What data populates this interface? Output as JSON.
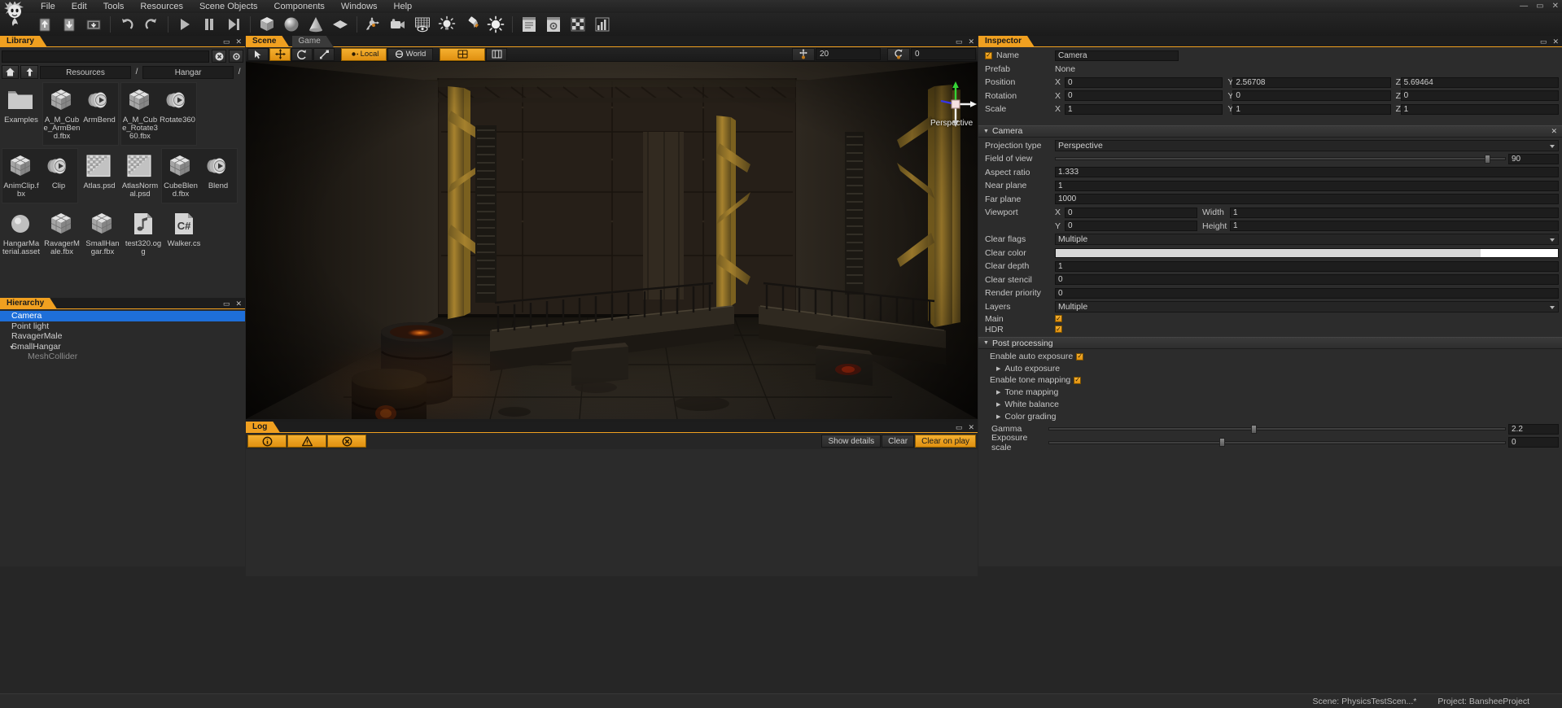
{
  "menu": {
    "items": [
      "File",
      "Edit",
      "Tools",
      "Resources",
      "Scene Objects",
      "Components",
      "Windows",
      "Help"
    ],
    "window_controls": [
      "—",
      "▭",
      "✕"
    ]
  },
  "toolbar": {
    "buttons": [
      {
        "name": "save-scene-icon",
        "title": "Save scene"
      },
      {
        "name": "load-scene-icon",
        "title": "Load scene"
      },
      {
        "name": "import-resource-icon",
        "title": "Import resource"
      },
      {
        "name": "undo-icon",
        "title": "Undo"
      },
      {
        "name": "redo-icon",
        "title": "Redo"
      },
      {
        "name": "play-icon",
        "title": "Play"
      },
      {
        "name": "pause-icon",
        "title": "Pause"
      },
      {
        "name": "step-icon",
        "title": "Step"
      },
      {
        "name": "add-cube-icon",
        "title": "Add cube"
      },
      {
        "name": "add-sphere-icon",
        "title": "Add sphere"
      },
      {
        "name": "add-cone-icon",
        "title": "Add cone"
      },
      {
        "name": "add-quad-icon",
        "title": "Add quad"
      },
      {
        "name": "add-empty-object-icon",
        "title": "Add empty scene object"
      },
      {
        "name": "add-camera-icon",
        "title": "Add camera"
      },
      {
        "name": "add-renderable-icon",
        "title": "Add renderable"
      },
      {
        "name": "add-point-light-icon",
        "title": "Add point light"
      },
      {
        "name": "add-spot-light-icon",
        "title": "Add spot light"
      },
      {
        "name": "add-directional-light-icon",
        "title": "Add directional light"
      },
      {
        "name": "project-settings-icon",
        "title": "Project settings"
      },
      {
        "name": "editor-settings-icon",
        "title": "Editor settings"
      },
      {
        "name": "build-icon",
        "title": "Build"
      },
      {
        "name": "profiler-icon",
        "title": "Profiler"
      }
    ]
  },
  "library": {
    "tab": "Library",
    "controls": [
      "▭",
      "✕"
    ],
    "search_value": "",
    "search_placeholder": "",
    "clear_search_icon": "clear-search-icon",
    "options_icon": "options-gear-icon",
    "home_icon": "home-icon",
    "up_icon": "up-arrow-icon",
    "breadcrumb": [
      "Resources",
      "/",
      "Hangar",
      "/"
    ],
    "groups": [
      {
        "standalone": true,
        "entries": [
          {
            "label": "Examples",
            "icon": "folder-icon"
          }
        ]
      },
      {
        "standalone": false,
        "entries": [
          {
            "label": "A_M_Cube_ArmBend.fbx",
            "icon": "mesh-icon"
          },
          {
            "label": "ArmBend",
            "icon": "animation-icon"
          }
        ]
      },
      {
        "standalone": false,
        "entries": [
          {
            "label": "A_M_Cube_Rotate360.fbx",
            "icon": "mesh-icon"
          },
          {
            "label": "Rotate360",
            "icon": "animation-icon"
          }
        ]
      },
      {
        "standalone": false,
        "entries": [
          {
            "label": "AnimClip.fbx",
            "icon": "mesh-icon"
          },
          {
            "label": "Clip",
            "icon": "animation-icon"
          }
        ]
      },
      {
        "standalone": true,
        "entries": [
          {
            "label": "Atlas.psd",
            "icon": "texture-icon"
          }
        ]
      },
      {
        "standalone": true,
        "entries": [
          {
            "label": "AtlasNormal.psd",
            "icon": "texture-icon"
          }
        ]
      },
      {
        "standalone": false,
        "entries": [
          {
            "label": "CubeBlend.fbx",
            "icon": "mesh-icon"
          },
          {
            "label": "Blend",
            "icon": "animation-icon"
          }
        ]
      },
      {
        "standalone": true,
        "entries": [
          {
            "label": "HangarMaterial.asset",
            "icon": "material-icon"
          }
        ]
      },
      {
        "standalone": true,
        "entries": [
          {
            "label": "RavagerMale.fbx",
            "icon": "mesh-icon"
          }
        ]
      },
      {
        "standalone": true,
        "entries": [
          {
            "label": "SmallHangar.fbx",
            "icon": "mesh-icon"
          }
        ]
      },
      {
        "standalone": true,
        "entries": [
          {
            "label": "test320.ogg",
            "icon": "audio-icon"
          }
        ]
      },
      {
        "standalone": true,
        "entries": [
          {
            "label": "Walker.cs",
            "icon": "script-icon"
          }
        ]
      }
    ]
  },
  "hierarchy": {
    "tab": "Hierarchy",
    "controls": [
      "▭",
      "✕"
    ],
    "items": [
      {
        "label": "Camera",
        "depth": 0,
        "selected": true,
        "expandable": false
      },
      {
        "label": "Point light",
        "depth": 0,
        "selected": false,
        "expandable": false
      },
      {
        "label": "RavagerMale",
        "depth": 0,
        "selected": false,
        "expandable": false
      },
      {
        "label": "SmallHangar",
        "depth": 0,
        "selected": false,
        "expandable": true
      },
      {
        "label": "MeshCollider",
        "depth": 1,
        "selected": false,
        "expandable": false
      }
    ]
  },
  "scene": {
    "tabs": [
      {
        "label": "Scene",
        "active": true
      },
      {
        "label": "Game",
        "active": false
      }
    ],
    "controls": [
      "▭",
      "✕"
    ],
    "toolbar": {
      "select_icon": "cursor-select-icon",
      "move_icon": "move-tool-icon",
      "rotate_icon": "rotate-tool-icon",
      "scale_icon": "scale-tool-icon",
      "pivot_label": "Local",
      "pivot_icon": "pivot-center-icon",
      "coord_label": "World",
      "coord_icon": "world-coord-icon",
      "move_snap_icon": "move-snap-icon",
      "rotate_snap_icon": "rotate-snap-icon",
      "view_options_icon": "view-options-icon",
      "grid_snap_icon": "grid-snap-icon",
      "move_snap_value": "20",
      "rotate_snap_value": "0"
    },
    "gizmo_label": "Perspective"
  },
  "log": {
    "tab": "Log",
    "controls": [
      "▭",
      "✕"
    ],
    "filters": [
      {
        "name": "info-filter",
        "icon": "info-icon"
      },
      {
        "name": "warning-filter",
        "icon": "warning-icon"
      },
      {
        "name": "error-filter",
        "icon": "error-icon"
      }
    ],
    "buttons": [
      {
        "label": "Show details",
        "active": false,
        "name": "show-details-button"
      },
      {
        "label": "Clear",
        "active": false,
        "name": "clear-button"
      },
      {
        "label": "Clear on play",
        "active": true,
        "name": "clear-on-play-button"
      }
    ]
  },
  "inspector": {
    "tab": "Inspector",
    "controls": [
      "▭",
      "✕"
    ],
    "object": {
      "name_label": "Name",
      "name_value": "Camera",
      "prefab_label": "Prefab",
      "prefab_value": "None",
      "position_label": "Position",
      "position": {
        "x": "0",
        "y": "2.56708",
        "z": "5.69464"
      },
      "rotation_label": "Rotation",
      "rotation": {
        "x": "0",
        "y": "0",
        "z": "0"
      },
      "scale_label": "Scale",
      "scale": {
        "x": "1",
        "y": "1",
        "z": "1"
      },
      "axes": [
        "X",
        "Y",
        "Z"
      ]
    },
    "camera": {
      "title": "Camera",
      "close_icon": "close-icon",
      "fields": [
        {
          "label": "Projection type",
          "value": "Perspective",
          "type": "dropdown",
          "name": "projection-type-dropdown"
        },
        {
          "label": "Field of view",
          "value": "90",
          "type": "slider",
          "knob_pct": 96,
          "name": "field-of-view-slider"
        },
        {
          "label": "Aspect ratio",
          "value": "1.333",
          "type": "text",
          "name": "aspect-ratio-field"
        },
        {
          "label": "Near plane",
          "value": "1",
          "type": "text",
          "name": "near-plane-field"
        },
        {
          "label": "Far plane",
          "value": "1000",
          "type": "text",
          "name": "far-plane-field"
        }
      ],
      "viewport_label": "Viewport",
      "viewport": {
        "x_label": "X",
        "x_value": "0",
        "width_label": "Width",
        "width_value": "1",
        "y_label": "Y",
        "y_value": "0",
        "height_label": "Height",
        "height_value": "1"
      },
      "clear_flags_label": "Clear flags",
      "clear_flags_value": "Multiple",
      "clear_color_label": "Clear color",
      "clear_color_hex": "#d8d8d8",
      "clear_color_swatch_hex": "#ffffff",
      "clear_depth_label": "Clear depth",
      "clear_depth_value": "1",
      "clear_stencil_label": "Clear stencil",
      "clear_stencil_value": "0",
      "render_priority_label": "Render priority",
      "render_priority_value": "0",
      "layers_label": "Layers",
      "layers_value": "Multiple",
      "main_label": "Main",
      "main_checked": true,
      "hdr_label": "HDR",
      "hdr_checked": true
    },
    "post_processing": {
      "title": "Post processing",
      "enable_auto_exposure_label": "Enable auto exposure",
      "enable_auto_exposure_checked": true,
      "auto_exposure_label": "Auto exposure",
      "enable_tone_mapping_label": "Enable tone mapping",
      "enable_tone_mapping_checked": true,
      "tone_mapping_label": "Tone mapping",
      "white_balance_label": "White balance",
      "color_grading_label": "Color grading",
      "gamma_label": "Gamma",
      "gamma_value": "2.2",
      "gamma_knob_pct": 45,
      "exposure_scale_label": "Exposure scale",
      "exposure_scale_value": "0",
      "exposure_scale_knob_pct": 38
    }
  },
  "status": {
    "scene_label": "Scene: PhysicsTestScen...*",
    "project_label": "Project: BansheeProject"
  },
  "colors": {
    "accent": "#f0a020",
    "selection": "#1e6fd9",
    "panel_bg": "#2a2a2a",
    "field_bg": "#1d1d1d"
  }
}
